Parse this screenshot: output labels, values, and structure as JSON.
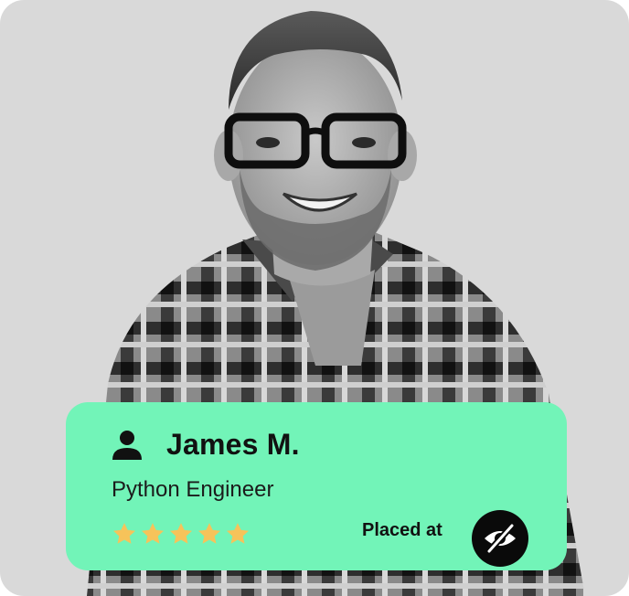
{
  "profile": {
    "name": "James M.",
    "role": "Python Engineer",
    "rating": 5,
    "rating_max": 5,
    "placed_label": "Placed at",
    "company_logo_icon": "hidden-eye-icon"
  },
  "colors": {
    "background": "#d9d9d9",
    "card_accent": "#72f4b8",
    "star": "#f6c35a",
    "text": "#111111",
    "logo": "#0a0a0a"
  },
  "icons": {
    "person": "person-icon",
    "star": "star-icon"
  }
}
